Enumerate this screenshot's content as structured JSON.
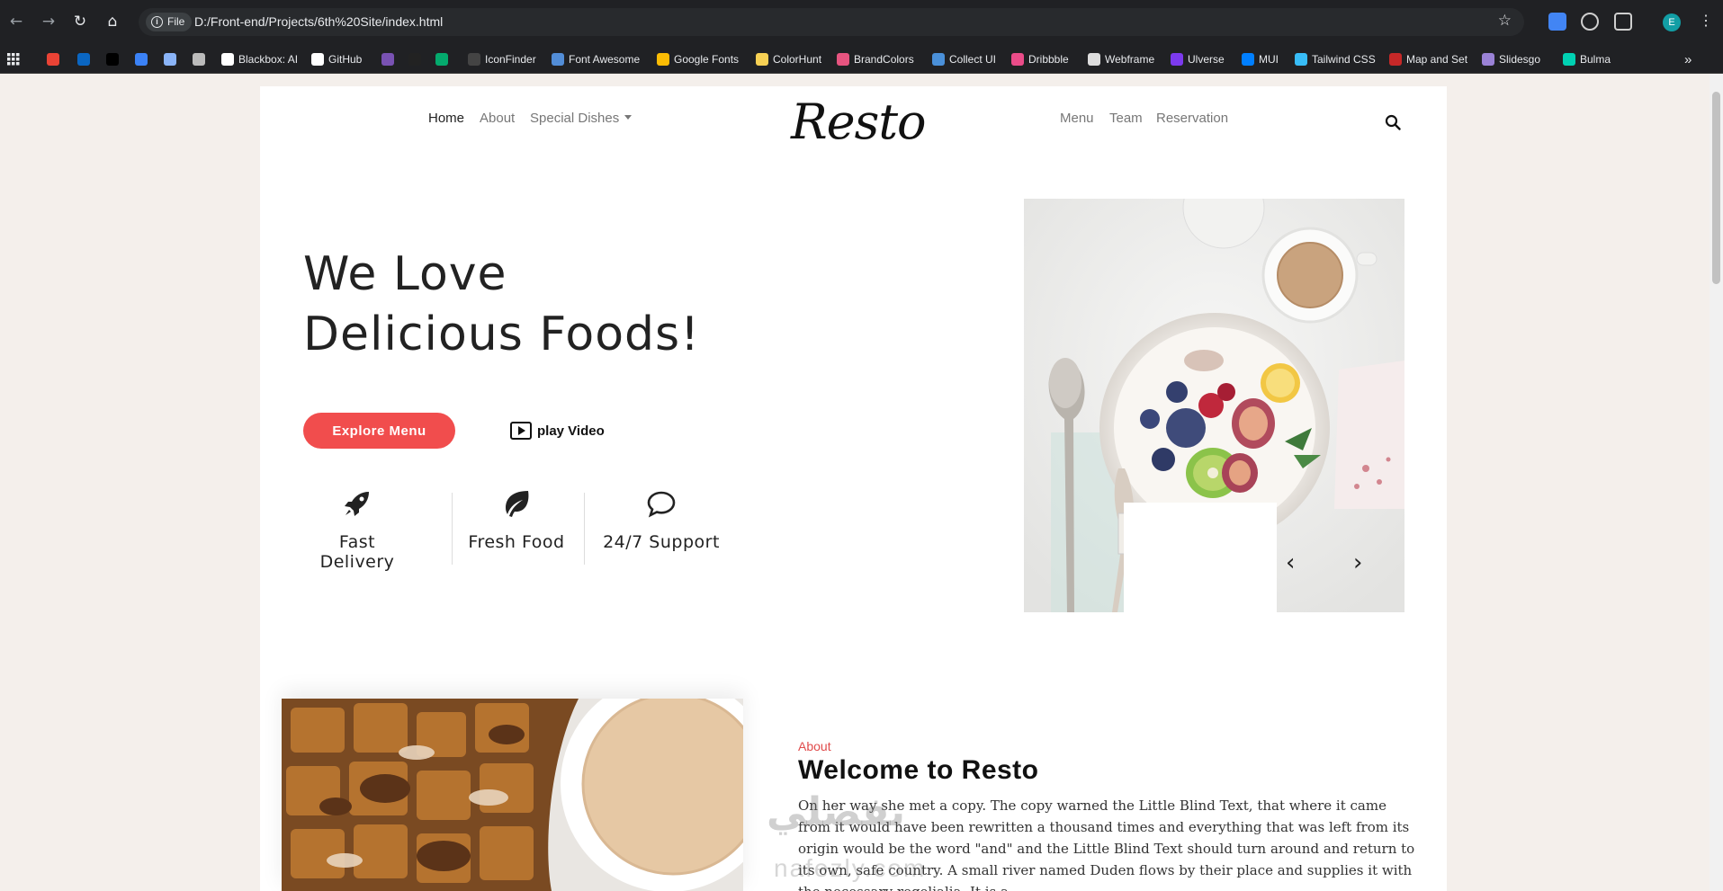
{
  "browser": {
    "file_label": "File",
    "url": "D:/Front-end/Projects/6th%20Site/index.html",
    "profile_initial": "E",
    "bookmarks": [
      {
        "label": "",
        "icon": "gmail-icon",
        "color": "#ea4335"
      },
      {
        "label": "",
        "icon": "linkedin-icon",
        "color": "#0a66c2"
      },
      {
        "label": "",
        "icon": "x-icon",
        "color": "#000000"
      },
      {
        "label": "",
        "icon": "copilot-icon",
        "color": "#3b82f6"
      },
      {
        "label": "",
        "icon": "gemini-icon",
        "color": "#8ab4f8"
      },
      {
        "label": "",
        "icon": "openai-icon",
        "color": "#bbbbbb"
      },
      {
        "label": "Blackbox: AI",
        "icon": "blackbox-icon",
        "color": "#ffffff"
      },
      {
        "label": "GitHub",
        "icon": "github-icon",
        "color": "#ffffff"
      },
      {
        "label": "",
        "icon": "bootstrap-icon",
        "color": "#7952b3"
      },
      {
        "label": "",
        "icon": "medium-icon",
        "color": "#222222"
      },
      {
        "label": "",
        "icon": "w3schools-icon",
        "color": "#04aa6d"
      },
      {
        "label": "IconFinder",
        "icon": "iconfinder-icon",
        "color": "#444444"
      },
      {
        "label": "Font Awesome",
        "icon": "fontawesome-icon",
        "color": "#528dd7"
      },
      {
        "label": "Google Fonts",
        "icon": "googlefonts-icon",
        "color": "#fbbc04"
      },
      {
        "label": "ColorHunt",
        "icon": "colorhunt-icon",
        "color": "#f7d154"
      },
      {
        "label": "BrandColors",
        "icon": "brandcolors-icon",
        "color": "#e75480"
      },
      {
        "label": "Collect UI",
        "icon": "collectui-icon",
        "color": "#4a90d9"
      },
      {
        "label": "Dribbble",
        "icon": "dribbble-icon",
        "color": "#ea4c89"
      },
      {
        "label": "Webframe",
        "icon": "webframe-icon",
        "color": "#dddddd"
      },
      {
        "label": "Ulverse",
        "icon": "uiverse-icon",
        "color": "#7c3aed"
      },
      {
        "label": "MUI",
        "icon": "mui-icon",
        "color": "#007fff"
      },
      {
        "label": "Tailwind CSS",
        "icon": "tailwind-icon",
        "color": "#38bdf8"
      },
      {
        "label": "Map and Set",
        "icon": "mapset-icon",
        "color": "#c62828"
      },
      {
        "label": "Slidesgo",
        "icon": "slidesgo-icon",
        "color": "#9a82d6"
      },
      {
        "label": "Bulma",
        "icon": "bulma-icon",
        "color": "#00d1b2"
      }
    ]
  },
  "nav": {
    "left": [
      "Home",
      "About",
      "Special Dishes"
    ],
    "logo": "Resto",
    "right": [
      "Menu",
      "Team",
      "Reservation"
    ]
  },
  "hero": {
    "title_line1": "We Love",
    "title_line2": "Delicious Foods!",
    "explore_label": "Explore Menu",
    "video_label": "play Video",
    "features": [
      "Fast Delivery",
      "Fresh Food",
      "24/7 Support"
    ]
  },
  "about": {
    "kicker": "About",
    "title": "Welcome to Resto",
    "text": "On her way she met a copy. The copy warned the Little Blind Text, that where it came from it would have been rewritten a thousand times and everything that was left from its origin would be the word \"and\" and the Little Blind Text should turn around and return to its own, safe country. A small river named Duden flows by their place and supplies it with the necessary regelialia. It is a"
  },
  "watermark": {
    "text": "نفضلي",
    "sub": "nafezly.com"
  },
  "colors": {
    "accent": "#f14d4d",
    "background": "#f4efeb"
  }
}
